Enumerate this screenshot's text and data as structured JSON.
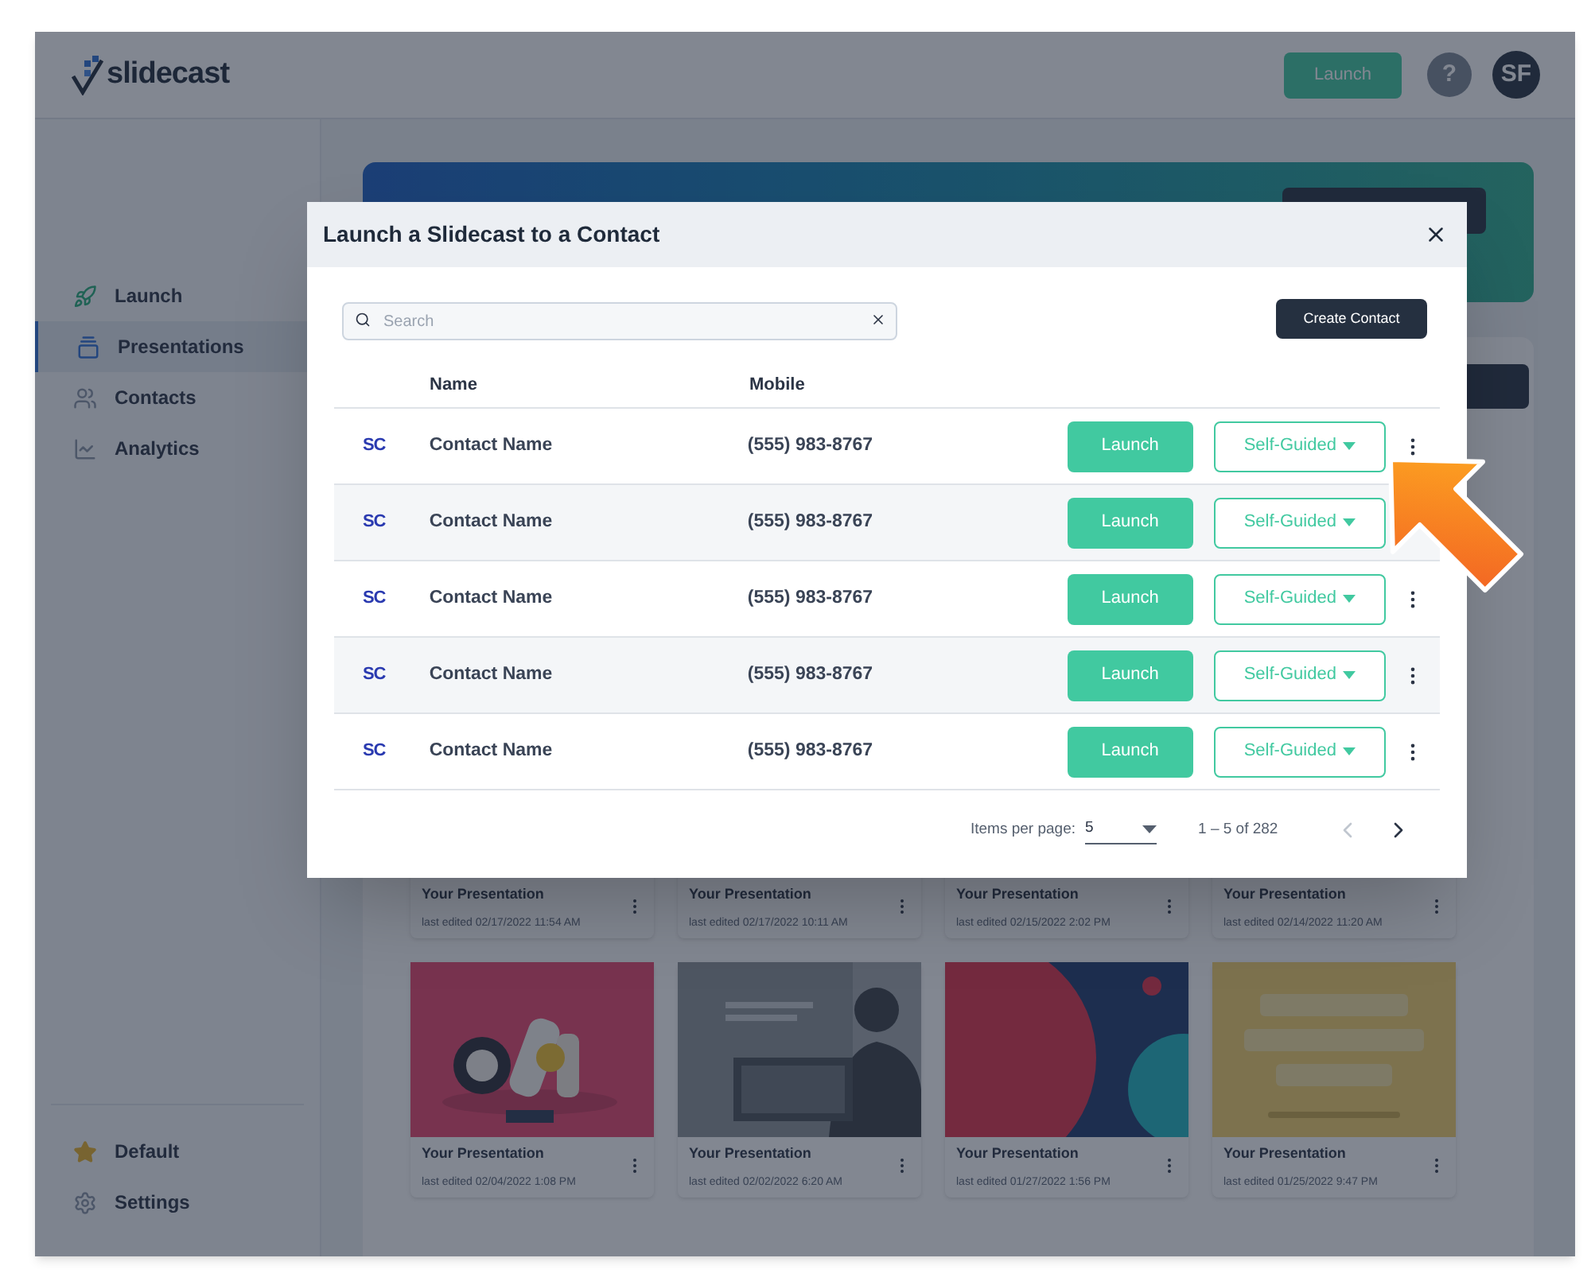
{
  "header": {
    "logo_text": "slidecast",
    "launch_button": "Launch",
    "help_button": "?",
    "avatar": "SF"
  },
  "sidebar": {
    "items": [
      {
        "label": "Launch",
        "selected": false
      },
      {
        "label": "Presentations",
        "selected": true
      },
      {
        "label": "Contacts",
        "selected": false
      },
      {
        "label": "Analytics",
        "selected": false
      }
    ],
    "bottom_items": [
      {
        "label": "Default"
      },
      {
        "label": "Settings"
      }
    ]
  },
  "cards": [
    {
      "kind": "partial",
      "title": "Your Presentation",
      "edited": "last edited 02/17/2022 11:54 AM"
    },
    {
      "kind": "partial",
      "title": "Your Presentation",
      "edited": "last edited 02/17/2022 10:11 AM"
    },
    {
      "kind": "partial",
      "title": "Your Presentation",
      "edited": "last edited 02/15/2022 2:02 PM"
    },
    {
      "kind": "partial",
      "title": "Your Presentation",
      "edited": "last edited 02/14/2022 11:20 AM"
    },
    {
      "kind": "picture",
      "title": "Your Presentation",
      "edited": "last edited 02/04/2022 1:08 PM"
    },
    {
      "kind": "picture",
      "title": "Your Presentation",
      "edited": "last edited 02/02/2022 6:20 AM"
    },
    {
      "kind": "picture",
      "title": "Your Presentation",
      "edited": "last edited 01/27/2022 1:56 PM"
    },
    {
      "kind": "picture",
      "title": "Your Presentation",
      "edited": "last edited 01/25/2022 9:47 PM"
    }
  ],
  "modal": {
    "title": "Launch a Slidecast to a Contact",
    "search": {
      "placeholder": "Search"
    },
    "create_button": "Create Contact",
    "columns": [
      "Name",
      "Mobile"
    ],
    "rows": [
      {
        "logo": "SC",
        "name": "Contact Name",
        "mobile": "(555) 983-8767",
        "launch": "Launch",
        "mode": "Self-Guided"
      },
      {
        "logo": "SC",
        "name": "Contact Name",
        "mobile": "(555) 983-8767",
        "launch": "Launch",
        "mode": "Self-Guided"
      },
      {
        "logo": "SC",
        "name": "Contact Name",
        "mobile": "(555) 983-8767",
        "launch": "Launch",
        "mode": "Self-Guided"
      },
      {
        "logo": "SC",
        "name": "Contact Name",
        "mobile": "(555) 983-8767",
        "launch": "Launch",
        "mode": "Self-Guided"
      },
      {
        "logo": "SC",
        "name": "Contact Name",
        "mobile": "(555) 983-8767",
        "launch": "Launch",
        "mode": "Self-Guided"
      }
    ],
    "pagination": {
      "items_label": "Items per page:",
      "per_page": "5",
      "range": "1 – 5 of 282",
      "prev": {
        "disabled": true
      },
      "next": {
        "disabled": false
      }
    }
  }
}
